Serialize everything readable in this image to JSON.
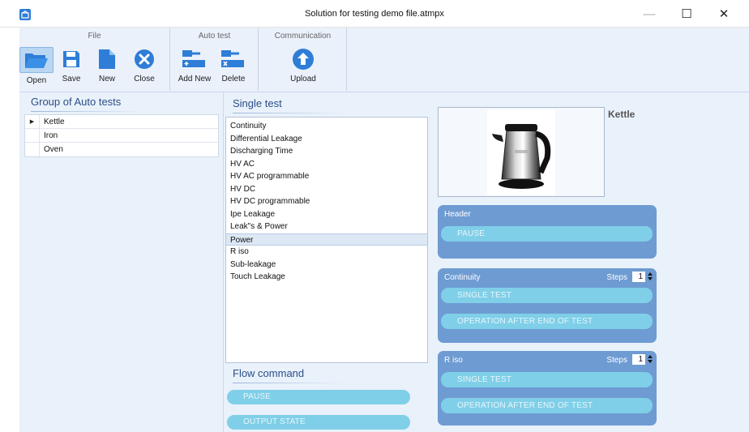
{
  "window": {
    "title": "Solution for testing demo file.atmpx",
    "minimize_label": "—",
    "maximize_label": "☐",
    "close_label": "✕"
  },
  "ribbon": {
    "groups": [
      {
        "label": "File"
      },
      {
        "label": "Auto test"
      },
      {
        "label": "Communication"
      }
    ],
    "buttons": {
      "open": "Open",
      "save": "Save",
      "new": "New",
      "close": "Close",
      "add_new": "Add New",
      "delete": "Delete",
      "upload": "Upload"
    },
    "accent_color": "#2e7dd7"
  },
  "group_panel": {
    "title": "Group of Auto tests",
    "rows": [
      {
        "name": "Kettle",
        "selected": true
      },
      {
        "name": "Iron",
        "selected": false
      },
      {
        "name": "Oven",
        "selected": false
      }
    ],
    "row_marker": "▶"
  },
  "single_test": {
    "title": "Single test",
    "items": [
      "Continuity",
      "Differential Leakage",
      "Discharging Time",
      "HV AC",
      "HV AC programmable",
      "HV DC",
      "HV DC programmable",
      "Ipe Leakage",
      "Leak\"s & Power",
      "Power",
      "R iso",
      "Sub-leakage",
      "Touch Leakage"
    ],
    "selected": "Power"
  },
  "flow_command": {
    "title": "Flow command",
    "items": [
      "PAUSE",
      "OUTPUT STATE"
    ]
  },
  "selected_group": {
    "name": "Kettle",
    "image_icon": "kettle-photo"
  },
  "cards": {
    "header": {
      "title": "Header",
      "items": [
        "PAUSE"
      ]
    },
    "continuity": {
      "title": "Continuity",
      "steps_label": "Steps",
      "steps_value": "1",
      "items": [
        "SINGLE TEST",
        "OPERATION AFTER END OF TEST"
      ]
    },
    "riso": {
      "title": "R iso",
      "steps_label": "Steps",
      "steps_value": "1",
      "items": [
        "SINGLE TEST",
        "OPERATION AFTER END OF TEST"
      ]
    }
  },
  "colors": {
    "card_blue": "#6e9bd2",
    "pill_cyan": "#7fcfe8",
    "panel_bg": "#e9f1fb"
  }
}
